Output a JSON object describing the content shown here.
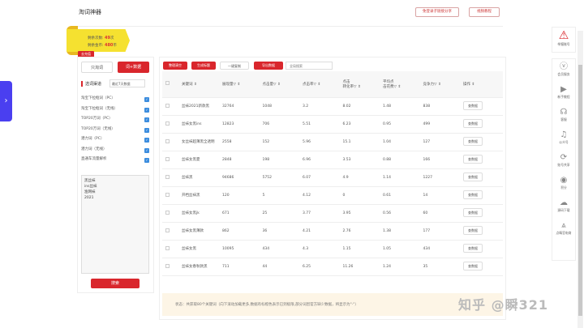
{
  "header": {
    "title": "淘词神器",
    "btn_share": "免登录子链接分享",
    "btn_video": "视频教程"
  },
  "quota": {
    "remain_times_label": "剩余次数:",
    "remain_times": "49",
    "times_unit": "次",
    "remain_coins_label": "剩余金币:",
    "remain_coins": "480",
    "coins_unit": "币",
    "recharge": "去充值"
  },
  "left": {
    "only_taobao": "只淘词",
    "fetch_data": "词+数据",
    "channel_label": "选词渠道",
    "channel_select": "最近7天数据",
    "channels": [
      "淘宝下拉框词（PC）",
      "淘宝下拉框词（无线）",
      "TOP20万词（PC）",
      "TOP20万词（无线）",
      "潜力词（PC）",
      "潜力词（无线）",
      "直通车流量解析"
    ],
    "keywords": "黑丝袜\nins丝袜\n渔网袜\n2021",
    "search": "搜索"
  },
  "toolbar": {
    "clear": "整理清空",
    "generate": "生成标题",
    "copy": "一键复制",
    "export": "导出数据",
    "filter_placeholder": "全局搜索"
  },
  "table": {
    "headers": [
      "关键词 ⇕",
      "展现量▽ ⇕",
      "点击量▽ ⇕",
      "点击率▽ ⇕",
      "点击\n转化率▽ ⇕",
      "平均点\n击花费▽ ⇕",
      "竞争力▽ ⇕",
      "操作 ⇕"
    ],
    "action_label": "查数据",
    "rows": [
      [
        "丝袜2021新款黑",
        "32764",
        "1048",
        "3.2",
        "8.02",
        "1.48",
        "838"
      ],
      [
        "丝袜女黑ins",
        "12823",
        "706",
        "5.51",
        "6.23",
        "0.95",
        "499"
      ],
      [
        "女丝袜超薄黑全透明",
        "2558",
        "152",
        "5.96",
        "15.1",
        "1.04",
        "127"
      ],
      [
        "丝袜女黑夏",
        "2848",
        "198",
        "6.96",
        "3.53",
        "0.88",
        "166"
      ],
      [
        "丝袜黑",
        "94686",
        "5752",
        "6.07",
        "4.9",
        "1.14",
        "1227"
      ],
      [
        "开档丝袜黑",
        "120",
        "5",
        "4.12",
        "0",
        "0.61",
        "14"
      ],
      [
        "丝袜女黑jk",
        "671",
        "25",
        "3.77",
        "3.95",
        "0.56",
        "60"
      ],
      [
        "丝袜女黑薄款",
        "862",
        "36",
        "4.21",
        "2.76",
        "1.38",
        "177"
      ],
      [
        "丝袜女黑",
        "10095",
        "434",
        "4.3",
        "1.15",
        "1.05",
        "434"
      ],
      [
        "丝袜女春秋款黑",
        "711",
        "44",
        "6.25",
        "11.26",
        "1.24",
        "35"
      ]
    ]
  },
  "status": "状态：共获取80个关键词（向下滚动加载更多,数据有标橙色表示已到极限,部分词因官方缺少数据，将显示为\"-\"）",
  "sidebar": {
    "alert": "举报账号",
    "items": [
      {
        "icon": "ⓥ",
        "label": "会员服务"
      },
      {
        "icon": "▶",
        "label": "新手教程"
      },
      {
        "icon": "☊",
        "label": "客服"
      },
      {
        "icon": "♫",
        "label": "公众号"
      },
      {
        "icon": "⟳",
        "label": "账号共享"
      },
      {
        "icon": "◉",
        "label": "积分"
      },
      {
        "icon": "☁",
        "label": "源码下载"
      },
      {
        "icon": "⩓",
        "label": "点睛官电商"
      }
    ]
  },
  "watermark": "知乎 @瞬321"
}
